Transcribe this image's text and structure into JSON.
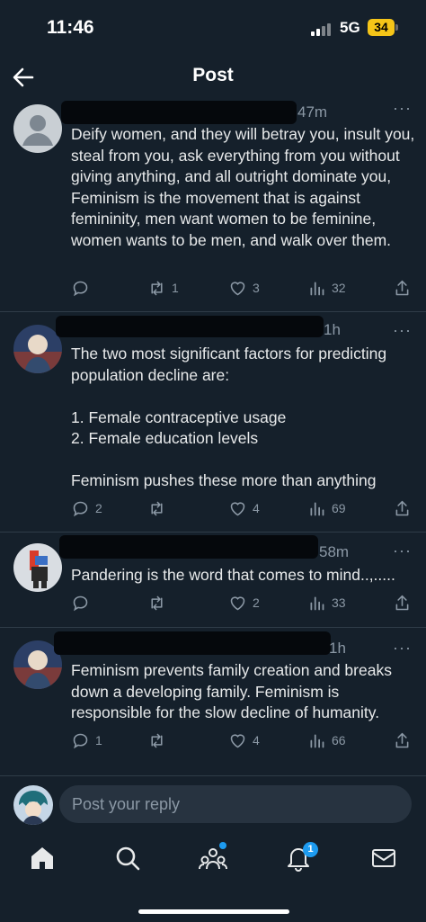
{
  "status_bar": {
    "time": "11:46",
    "network": "5G",
    "battery": "34"
  },
  "header": {
    "title": "Post"
  },
  "posts": [
    {
      "time_ago": "47m",
      "text": "Deify women, and they will betray you, insult you, steal from you, ask everything from you without giving anything, and all outright dominate you, Feminism is the movement that is against femininity, men want women to be feminine, women wants to be men, and walk over them.",
      "replies": "",
      "reposts": "1",
      "likes": "3",
      "views": "32"
    },
    {
      "time_ago": "1h",
      "text": "The two most significant factors for predicting population decline are:\n\n1. Female contraceptive usage\n2. Female education levels\n\nFeminism pushes these more than anything",
      "replies": "2",
      "reposts": "",
      "likes": "4",
      "views": "69"
    },
    {
      "time_ago": "58m",
      "text": "Pandering is the word that comes to mind..,.....",
      "replies": "",
      "reposts": "",
      "likes": "2",
      "views": "33"
    },
    {
      "time_ago": "1h",
      "text": "Feminism prevents family creation and breaks down a developing family. Feminism is responsible for the slow decline of humanity.",
      "replies": "1",
      "reposts": "",
      "likes": "4",
      "views": "66"
    }
  ],
  "reply_bar": {
    "placeholder": "Post your reply"
  },
  "tab_bar": {
    "notifications_badge": "1"
  },
  "colors": {
    "background": "#15202b",
    "accent": "#1d9bf0",
    "muted": "#8b98a5"
  },
  "icons": [
    "back-arrow-icon",
    "reply-icon",
    "repost-icon",
    "like-icon",
    "views-icon",
    "share-icon",
    "home-icon",
    "search-icon",
    "communities-icon",
    "notifications-icon",
    "messages-icon"
  ]
}
